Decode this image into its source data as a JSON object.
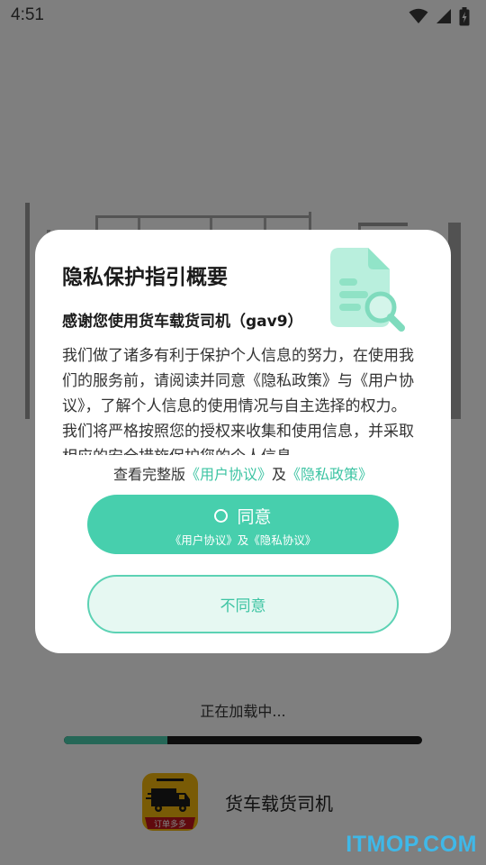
{
  "status_bar": {
    "time": "4:51"
  },
  "loading": {
    "text": "正在加载中...",
    "progress": 0.29
  },
  "brand": {
    "logo_text": "订单多多",
    "app_name": "货车载货司机"
  },
  "watermark": "ITMOP.COM",
  "dialog": {
    "title": "隐私保护指引概要",
    "subtitle": "感谢您使用货车载货司机（gav9）",
    "body": "我们做了诸多有利于保护个人信息的努力，在使用我们的服务前，请阅读并同意《隐私政策》与《用户协议》，了解个人信息的使用情况与自主选择的权力。我们将严格按照您的授权来收集和使用信息，并采取相应的安全措施保护您的个人信息。",
    "full_version": {
      "prefix": "查看完整版",
      "user_agreement_link": "《用户协议》",
      "and": "及",
      "privacy_policy_link": "《隐私政策》"
    },
    "agree_button": {
      "label": "同意",
      "sub": "《用户协议》及《隐私协议》"
    },
    "disagree_button": {
      "label": "不同意"
    }
  },
  "colors": {
    "accent": "#47cfad",
    "link": "#3dc4a3",
    "progress_track": "#1c1c1c",
    "brand_yellow": "#f3b70d"
  },
  "icons": [
    "wifi-icon",
    "signal-icon",
    "battery-icon",
    "document-search-icon",
    "truck-icon"
  ]
}
